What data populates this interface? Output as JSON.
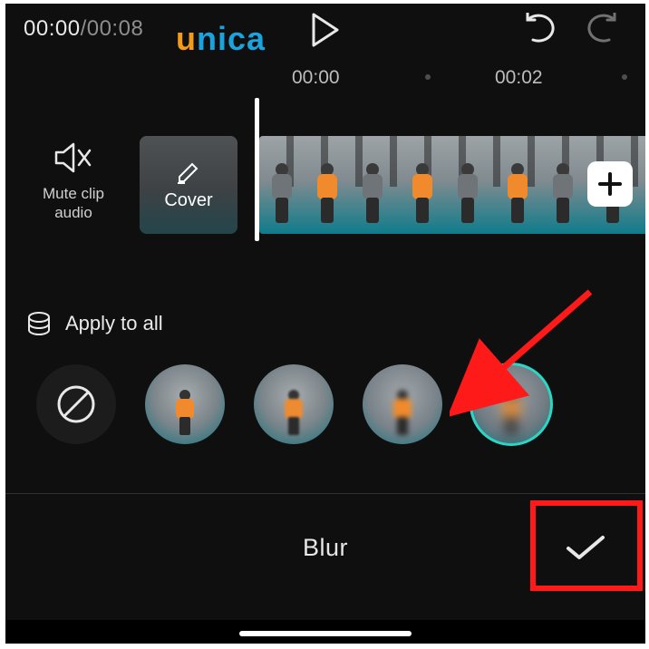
{
  "topbar": {
    "current_time": "00:00",
    "duration": "00:08"
  },
  "watermark": {
    "part1": "u",
    "part2": "nica"
  },
  "ruler": {
    "tick1": "00:00",
    "tick2": "00:02"
  },
  "track": {
    "mute_label": "Mute clip audio",
    "cover_label": "Cover"
  },
  "blur_panel": {
    "apply_all_label": "Apply to all",
    "title": "Blur",
    "options": [
      "none",
      "level0",
      "level1",
      "level2",
      "level3"
    ],
    "selected_index": 4
  },
  "icons": {
    "play": "play-icon",
    "undo": "undo-icon",
    "redo": "redo-icon",
    "mute": "speaker-mute-icon",
    "edit": "pencil-icon",
    "add": "plus-icon",
    "stack": "stack-icon",
    "none": "no-symbol-icon",
    "confirm": "check-icon"
  },
  "colors": {
    "accent": "#2bd6c4",
    "annotation": "#ff1a1a",
    "brand_orange": "#f59b1a",
    "brand_blue": "#1aa3dc"
  }
}
